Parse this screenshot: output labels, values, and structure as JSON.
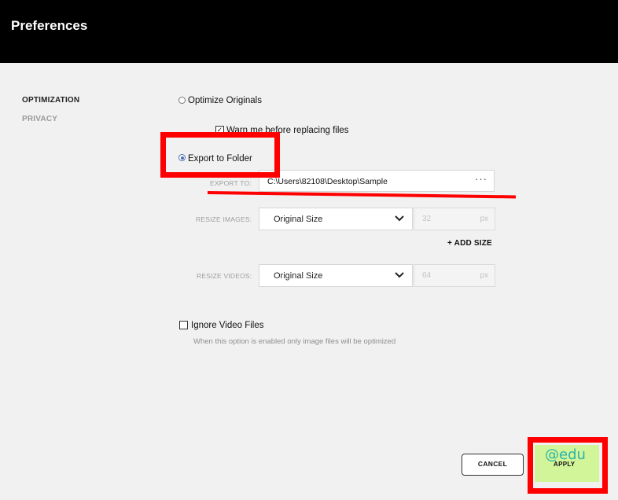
{
  "header": {
    "title": "Preferences"
  },
  "sidebar": {
    "items": [
      {
        "label": "OPTIMIZATION"
      },
      {
        "label": "PRIVACY"
      }
    ]
  },
  "options": {
    "optimize_originals": {
      "label": "Optimize Originals",
      "selected": false
    },
    "warn_replace": {
      "label": "Warn me before replacing files",
      "checked": true
    },
    "export_folder": {
      "label": "Export to Folder",
      "selected": true
    },
    "export_to": {
      "label": "EXPORT TO:",
      "value": "C:\\Users\\82108\\Desktop\\Sample",
      "browse_icon": "ellipsis-icon"
    },
    "resize_images": {
      "label": "RESIZE IMAGES:",
      "value": "Original Size",
      "size": "32",
      "unit": "px"
    },
    "add_size": {
      "label": "+ ADD SIZE"
    },
    "resize_videos": {
      "label": "RESIZE VIDEOS:",
      "value": "Original Size",
      "size": "64",
      "unit": "px"
    },
    "ignore_video": {
      "label": "Ignore Video Files",
      "checked": false,
      "hint": "When this option is enabled only image files will be optimized"
    }
  },
  "footer": {
    "cancel_label": "CANCEL",
    "apply_label": "APPLY",
    "watermark": "@edu"
  },
  "colors": {
    "header_bg": "#000000",
    "apply_bg": "#d2f59a",
    "annotation": "#ff0000",
    "radio_accent": "#4a6fb5"
  }
}
